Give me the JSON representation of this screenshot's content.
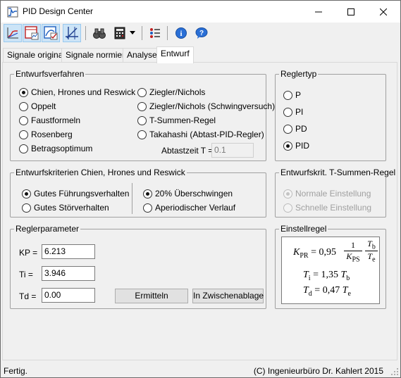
{
  "window": {
    "title": "PID Design Center"
  },
  "toolbar": {
    "buttons": [
      "step-response-icon",
      "table-chart-icon",
      "chart-check-icon",
      "axis-icon",
      "binoculars-icon",
      "calculator-icon",
      "dropdown-arrow-icon",
      "list-icon",
      "info-icon",
      "help-icon"
    ]
  },
  "tabs": [
    "Signale original",
    "Signale normiert",
    "Analyse",
    "Entwurf"
  ],
  "selected_tab": "Entwurf",
  "entwurfsverfahren": {
    "title": "Entwurfsverfahren",
    "options_left": [
      "Chien, Hrones und Reswick",
      "Oppelt",
      "Faustformeln",
      "Rosenberg",
      "Betragsoptimum"
    ],
    "options_right": [
      "Ziegler/Nichols",
      "Ziegler/Nichols (Schwingversuch)",
      "T-Summen-Regel",
      "Takahashi (Abtast-PID-Regler)"
    ],
    "selected": "Chien, Hrones und Reswick",
    "abtastzeit_label": "Abtastzeit T =",
    "abtastzeit_value": "0.1"
  },
  "reglertyp": {
    "title": "Reglertyp",
    "options": [
      "P",
      "PI",
      "PD",
      "PID"
    ],
    "selected": "PID"
  },
  "kriterien_chr": {
    "title": "Entwurfskriterien Chien, Hrones und Reswick",
    "left": [
      "Gutes Führungsverhalten",
      "Gutes Störverhalten"
    ],
    "right": [
      "20% Überschwingen",
      "Aperiodischer Verlauf"
    ],
    "selected_left": "Gutes Führungsverhalten",
    "selected_right": "20% Überschwingen"
  },
  "kriterien_tsum": {
    "title": "Entwurfskrit. T-Summen-Regel",
    "options": [
      "Normale Einstellung",
      "Schnelle Einstellung"
    ],
    "selected": "Normale Einstellung"
  },
  "reglerparameter": {
    "title": "Reglerparameter",
    "kp_label": "KP =",
    "kp_value": "6.213",
    "ti_label": "Ti =",
    "ti_value": "3.946",
    "td_label": "Td =",
    "td_value": "0.00",
    "ermitteln_label": "Ermitteln",
    "clipboard_label": "In Zwischenablage"
  },
  "einstellregel": {
    "title": "Einstellregel",
    "kpr_sym": "K",
    "kpr_sub": "PR",
    "eq1": "= 0,95",
    "one": "1",
    "kps_sym": "K",
    "kps_sub": "PS",
    "tb_sym": "T",
    "tb_sub": "b",
    "te_sym": "T",
    "te_sub": "e",
    "ti_sym": "T",
    "ti_sub": "i",
    "eq2": "= 1,35",
    "ti_tb_sym": "T",
    "ti_tb_sub": "b",
    "td_sym": "T",
    "td_sub": "d",
    "eq3": "= 0,47",
    "td_te_sym": "T",
    "td_te_sub": "e"
  },
  "status": {
    "left": "Fertig.",
    "right": "(C) Ingenieurbüro Dr. Kahlert 2015"
  }
}
